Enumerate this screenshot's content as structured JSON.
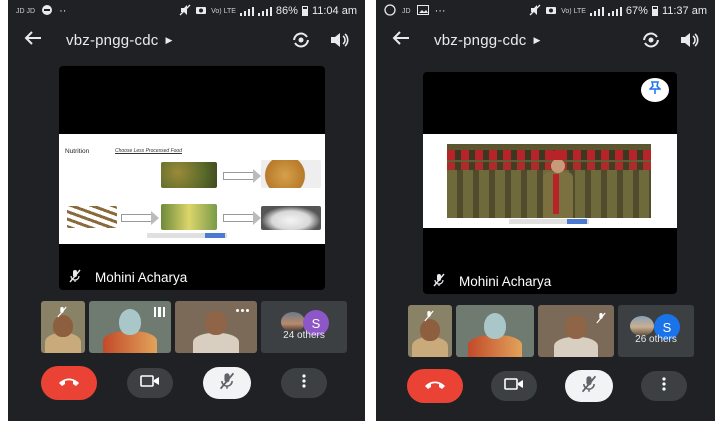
{
  "screens": [
    {
      "status": {
        "left_glyphs": "JD  JD",
        "dots": "··",
        "network": "Vo) LTE",
        "battery": "86%",
        "time": "11:04 am"
      },
      "meeting_code": "vbz-pngg-cdc",
      "presenter_name": "Mohini Acharya",
      "slide": {
        "title": "Nutrition",
        "subtitle": "Choose Less Processed Food"
      },
      "others_label": "24 others",
      "avatar_letter": "S"
    },
    {
      "status": {
        "left_glyphs": "JD",
        "dots": "···",
        "network": "Vo) LTE",
        "battery": "67%",
        "time": "11:37 am"
      },
      "meeting_code": "vbz-pngg-cdc",
      "presenter_name": "Mohini Acharya",
      "others_label": "26 others",
      "avatar_letter": "S"
    }
  ],
  "colors": {
    "background": "#202124",
    "end_call": "#ea4335",
    "avatar_s": "#8e57c7",
    "tile": "#3c4043"
  },
  "icons": [
    "back-arrow-icon",
    "dropdown-caret-icon",
    "switch-camera-icon",
    "speaker-icon",
    "mic-off-icon",
    "pin-icon",
    "end-call-icon",
    "camera-icon",
    "more-options-icon"
  ]
}
